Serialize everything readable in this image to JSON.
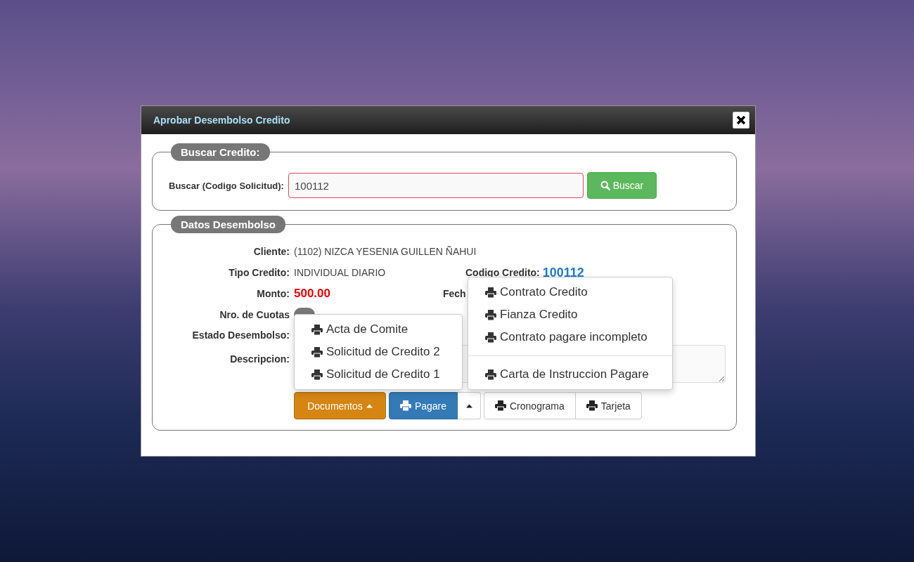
{
  "window": {
    "title": "Aprobar Desembolso Credito"
  },
  "search_section": {
    "legend": "Buscar Credito:",
    "label": "Buscar (Codigo Solicitud):",
    "value": "100112",
    "button": "Buscar"
  },
  "details_section": {
    "legend": "Datos Desembolso",
    "fields": [
      {
        "label": "Cliente:",
        "value": "(1102) NIZCA YESENIA GUILLEN ÑAHUI",
        "kind": "text"
      },
      {
        "label": "Tipo Credito:",
        "value": "INDIVIDUAL DIARIO",
        "kind": "text"
      },
      {
        "label": "Monto:",
        "value": "500.00",
        "kind": "amount"
      },
      {
        "label": "Nro. de Cuotas",
        "kind": "badge"
      },
      {
        "label": "Estado Desembolso:",
        "kind": "covered"
      },
      {
        "label": "Descripcion:",
        "kind": "textarea"
      }
    ],
    "right_fields": [
      {
        "label": "Codigo Credito:",
        "value": "100112"
      },
      {
        "label": "Fech"
      }
    ]
  },
  "buttons": [
    {
      "label": "Documentos",
      "kind": "dropdown",
      "expanded": true
    },
    {
      "label": "Pagare",
      "kind": "split",
      "expanded": true
    },
    {
      "label": "Cronograma",
      "kind": "print"
    },
    {
      "label": "Tarjeta",
      "kind": "print"
    }
  ],
  "documentos_menu": [
    {
      "label": "Acta de Comite"
    },
    {
      "label": "Solicitud de Credito 2"
    },
    {
      "label": "Solicitud de Credito 1"
    }
  ],
  "pagare_menu": [
    {
      "label": "Contrato Credito",
      "divider_before": false
    },
    {
      "label": "Fianza Credito",
      "divider_before": false
    },
    {
      "label": "Contrato pagare incompleto",
      "divider_before": false
    },
    {
      "label": "Carta de Instruccion Pagare",
      "divider_before": true
    }
  ]
}
